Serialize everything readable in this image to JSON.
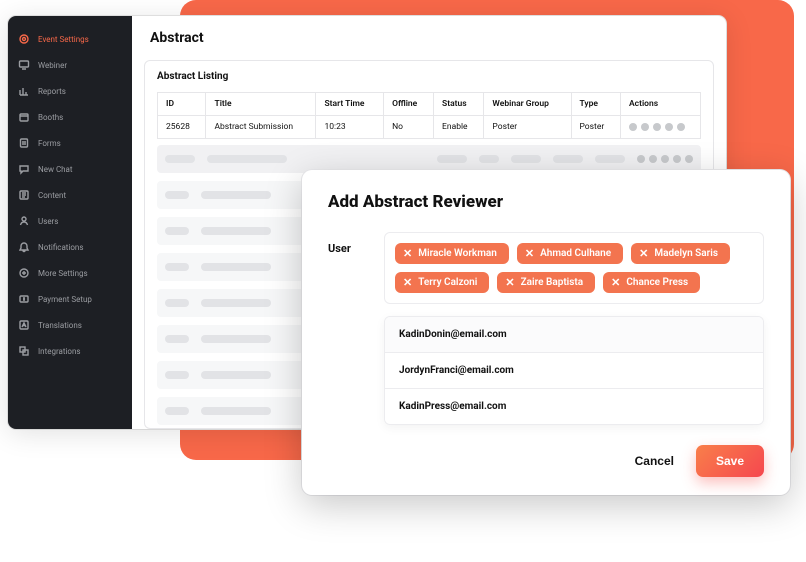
{
  "sidebar": {
    "items": [
      {
        "label": "Event Settings",
        "icon": "gear-icon",
        "active": true
      },
      {
        "label": "Webiner",
        "icon": "monitor-icon",
        "active": false
      },
      {
        "label": "Reports",
        "icon": "chart-icon",
        "active": false
      },
      {
        "label": "Booths",
        "icon": "booth-icon",
        "active": false
      },
      {
        "label": "Forms",
        "icon": "form-icon",
        "active": false
      },
      {
        "label": "New Chat",
        "icon": "chat-icon",
        "active": false
      },
      {
        "label": "Content",
        "icon": "content-icon",
        "active": false
      },
      {
        "label": "Users",
        "icon": "users-icon",
        "active": false
      },
      {
        "label": "Notifications",
        "icon": "bell-icon",
        "active": false
      },
      {
        "label": "More Settings",
        "icon": "more-icon",
        "active": false
      },
      {
        "label": "Payment Setup",
        "icon": "payment-icon",
        "active": false
      },
      {
        "label": "Translations",
        "icon": "translate-icon",
        "active": false
      },
      {
        "label": "Integrations",
        "icon": "integrations-icon",
        "active": false
      }
    ]
  },
  "page": {
    "title": "Abstract"
  },
  "listing": {
    "title": "Abstract Listing",
    "columns": [
      "ID",
      "Title",
      "Start Time",
      "Offline",
      "Status",
      "Webinar Group",
      "Type",
      "Actions"
    ],
    "rows": [
      {
        "id": "25628",
        "title": "Abstract Submission",
        "start": "10:23",
        "offline": "No",
        "status": "Enable",
        "group": "Poster",
        "type": "Poster"
      }
    ]
  },
  "modal": {
    "title": "Add Abstract Reviewer",
    "user_label": "User",
    "chips": [
      "Miracle Workman",
      "Ahmad Culhane",
      "Madelyn Saris",
      "Terry Calzoni",
      "Zaire Baptista",
      "Chance Press"
    ],
    "suggestions": [
      "KadinDonin@email.com",
      "JordynFranci@email.com",
      "KadinPress@email.com"
    ],
    "cancel_label": "Cancel",
    "save_label": "Save"
  },
  "colors": {
    "accent": "#f86849",
    "chip": "#f3744f"
  }
}
